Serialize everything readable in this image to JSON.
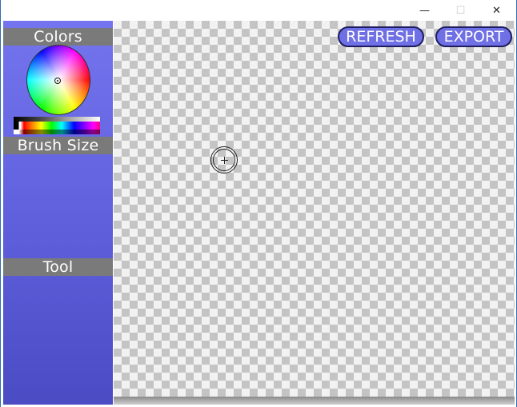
{
  "window": {
    "minimize_glyph": "—",
    "maximize_glyph": "☐",
    "close_glyph": "✕"
  },
  "sidebar": {
    "colors_label": "Colors",
    "brush_size_label": "Brush Size",
    "tool_label": "Tool"
  },
  "toolbar": {
    "refresh_label": "REFRESH",
    "export_label": "EXPORT"
  },
  "colors": {
    "sidebar_top": "#7474ee",
    "sidebar_bottom": "#4b4bc4",
    "button_fill": "#6f6fe6",
    "header_gray": "#7a7a7a"
  },
  "icons": {
    "color_wheel": "color-wheel-icon",
    "brush_cursor": "brush-cursor-icon"
  }
}
